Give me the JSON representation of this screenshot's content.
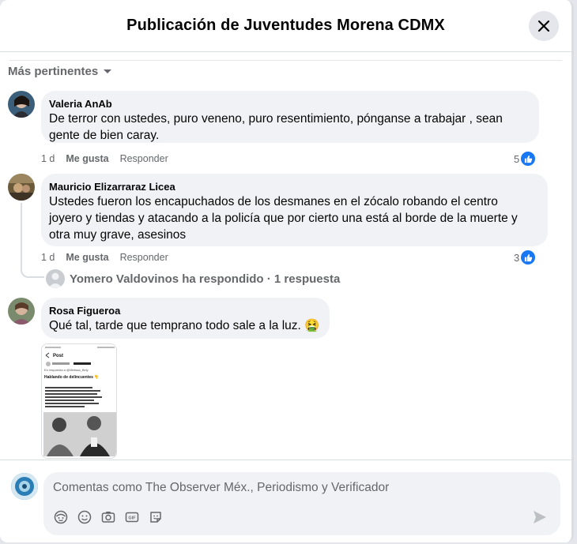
{
  "dialog": {
    "title": "Publicación de Juventudes Morena CDMX"
  },
  "sort": {
    "label": "Más pertinentes"
  },
  "comments": [
    {
      "author": "Valeria AnAb",
      "text_lines": [
        "De terror con ustedes, puro veneno, puro resentimiento, pónganse a trabajar , sean",
        "gente de bien caray."
      ],
      "time": "1 d",
      "like_label": "Me gusta",
      "reply_label": "Responder",
      "reaction_count": "5"
    },
    {
      "author": "Mauricio Elizarraraz Licea",
      "text_lines": [
        "Ustedes fueron los encapuchados de los desmanes en el zócalo robando el centro",
        "joyero y tiendas y atacando a la policía que por cierto una está al borde de la muerte y",
        "otra muy grave, asesinos"
      ],
      "time": "1 d",
      "like_label": "Me gusta",
      "reply_label": "Responder",
      "reaction_count": "3",
      "replies_summary": "Yomero Valdovinos ha respondido · 1 respuesta"
    },
    {
      "author": "Rosa Figueroa",
      "text": "Qué tal, tarde que temprano todo sale a la luz. 🤮"
    }
  ],
  "attachment": {
    "title": "Post",
    "reply_to": "En respuesta a @Melissa_Bely",
    "heading": "Hablando de delincuentes 👇"
  },
  "composer": {
    "placeholder": "Comentas como The Observer Méx., Periodismo y Verificador"
  },
  "icons": {
    "close": "close-icon",
    "sort": "caret-down-icon",
    "like_reaction": "thumbs-up-icon",
    "avatar_sticker": "avatar-sticker-icon",
    "emoji": "emoji-icon",
    "camera": "camera-icon",
    "gif": "gif-icon",
    "sticker": "sticker-icon",
    "send": "send-icon"
  },
  "colors": {
    "accent": "#1877f2",
    "bubble": "#f0f2f5",
    "secondary_text": "#65676b"
  }
}
